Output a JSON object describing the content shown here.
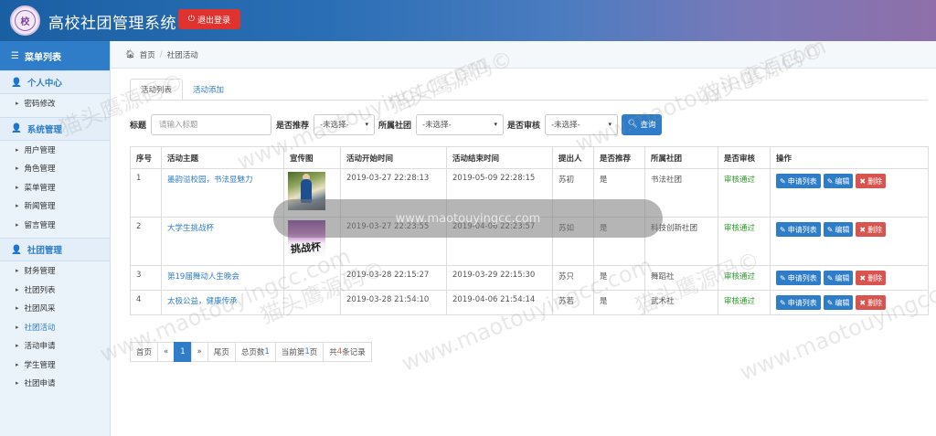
{
  "header": {
    "logo_text": "校",
    "title": "高校社团管理系统",
    "logout_label": "退出登录"
  },
  "sidebar": {
    "menu_title": "菜单列表",
    "groups": [
      {
        "title": "个人中心",
        "items": [
          "密码修改"
        ]
      },
      {
        "title": "系统管理",
        "items": [
          "用户管理",
          "角色管理",
          "菜单管理",
          "新闻管理",
          "留言管理"
        ]
      },
      {
        "title": "社团管理",
        "items": [
          "财务管理",
          "社团列表",
          "社团风采",
          "社团活动",
          "活动申请",
          "学生管理",
          "社团申请"
        ]
      }
    ],
    "active_item": "社团活动"
  },
  "breadcrumb": {
    "home": "首页",
    "current": "社团活动"
  },
  "tabs": [
    {
      "label": "活动列表",
      "active": true
    },
    {
      "label": "活动添加",
      "active": false
    }
  ],
  "filters": {
    "title_label": "标题",
    "title_placeholder": "请输入标题",
    "recommend_label": "是否推荐",
    "recommend_value": "-未选择-",
    "club_label": "所属社团",
    "club_value": "-未选择-",
    "audit_label": "是否审核",
    "audit_value": "-未选择-",
    "search_label": "查询"
  },
  "table": {
    "headers": [
      "序号",
      "活动主题",
      "宣传图",
      "活动开始时间",
      "活动结束时间",
      "提出人",
      "是否推荐",
      "所属社团",
      "是否审核",
      "操作"
    ],
    "rows": [
      {
        "no": "1",
        "title": "墨韵溢校园，书法显魅力",
        "start": "2019-03-27 22:28:13",
        "end": "2019-05-09 22:28:15",
        "proposer": "苏初",
        "recommend": "是",
        "club": "书法社团",
        "status": "审核通过"
      },
      {
        "no": "2",
        "title": "大学生挑战杯",
        "start": "2019-03-27 22:23:55",
        "end": "2019-04-06 22:23:57",
        "proposer": "苏如",
        "recommend": "是",
        "club": "科技创新社团",
        "status": "审核通过"
      },
      {
        "no": "3",
        "title": "第19届舞动人生晚会",
        "start": "2019-03-28 22:15:27",
        "end": "2019-03-29 22:15:30",
        "proposer": "苏只",
        "recommend": "是",
        "club": "舞蹈社",
        "status": "审核通过"
      },
      {
        "no": "4",
        "title": "太极公益，健康传承",
        "start": "2019-03-28 21:54:10",
        "end": "2019-04-06 21:54:14",
        "proposer": "苏若",
        "recommend": "是",
        "club": "武术社",
        "status": "审核通过"
      }
    ],
    "op_labels": {
      "apply_list": "申请列表",
      "edit": "编辑",
      "delete": "删除"
    },
    "thumb2_text": "挑战杯"
  },
  "pagination": {
    "first": "首页",
    "prev": "«",
    "current": "1",
    "next": "»",
    "last": "尾页",
    "total_pages_prefix": "总页数",
    "total_pages": "1",
    "current_page_prefix": "当前第",
    "current_page": "1",
    "current_page_suffix": "页",
    "records_prefix": "共",
    "records": "4",
    "records_suffix": "条记录"
  },
  "watermark": {
    "text1": "猫头鹰源码©",
    "text2": "www.maotouyingcc.com"
  },
  "colors": {
    "primary": "#2f7dc8",
    "danger": "#d9534f",
    "success": "#2a9a2a"
  }
}
